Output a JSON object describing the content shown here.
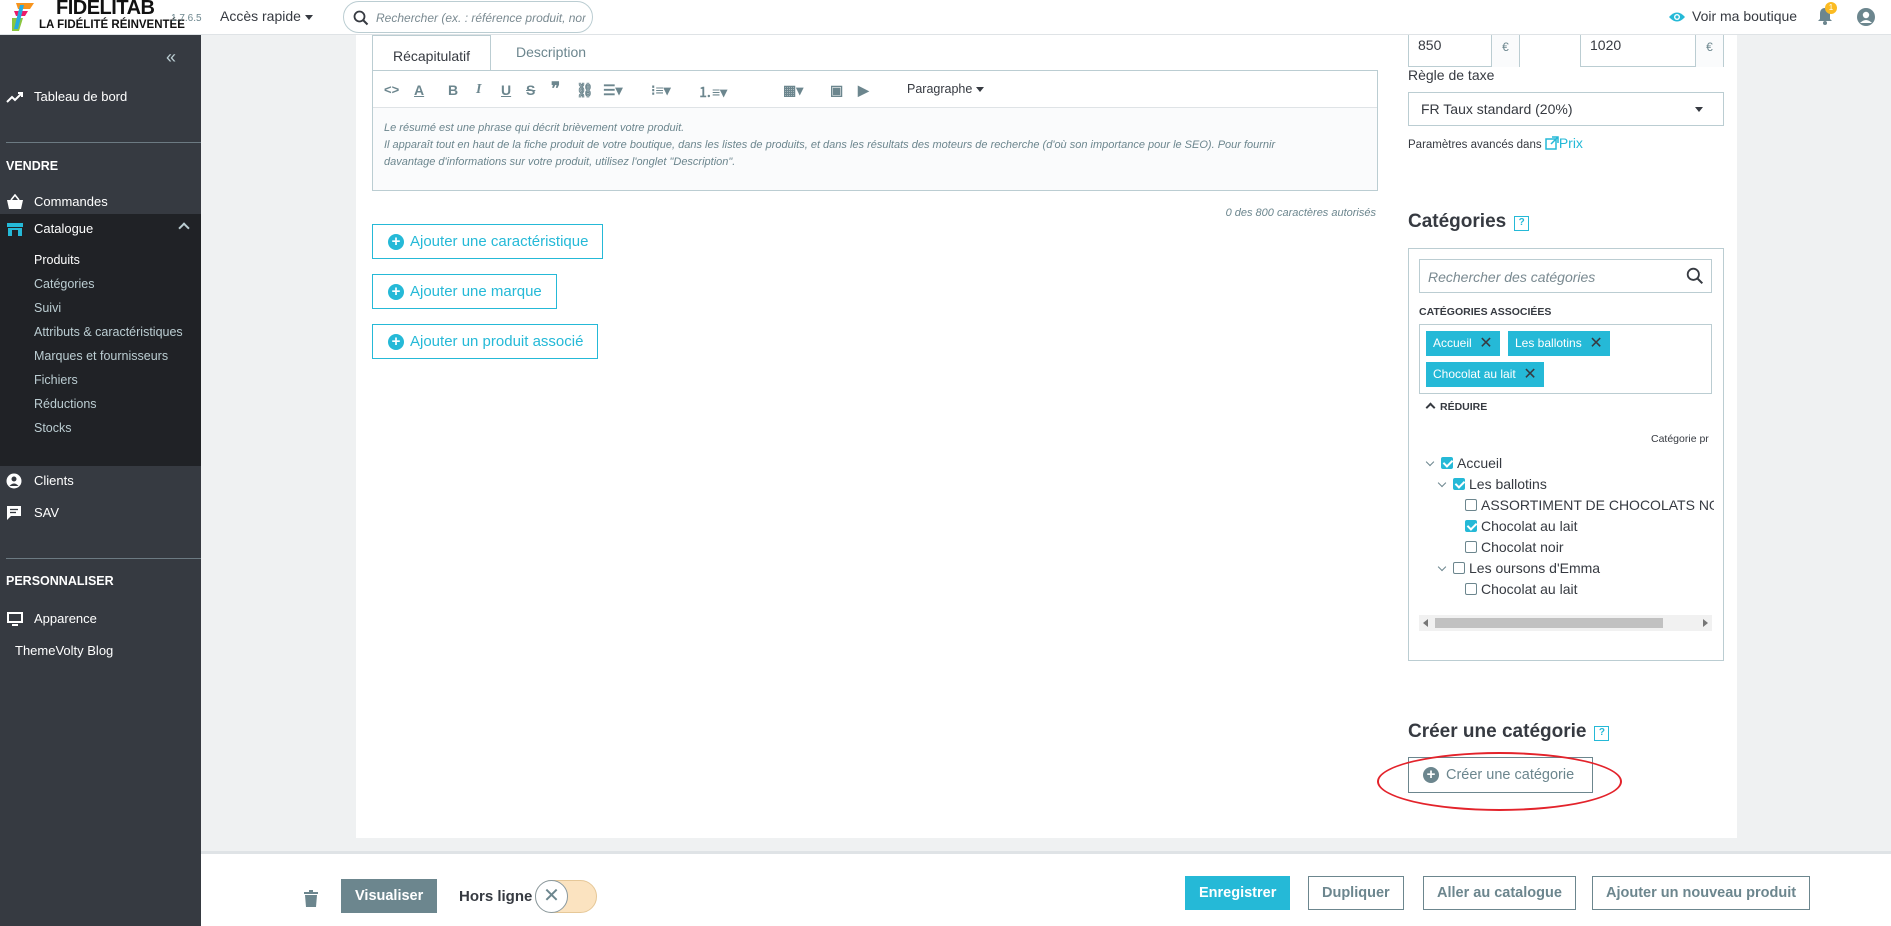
{
  "topbar": {
    "brand": "FIDELITAB",
    "tagline": "LA FIDÉLITÉ RÉINVENTÉE",
    "version": "1.7.6.5",
    "quick_access": "Accès rapide",
    "search_placeholder": "Rechercher (ex. : référence produit, nom",
    "view_shop": "Voir ma boutique",
    "notifications_count": "1"
  },
  "sidebar": {
    "dashboard": "Tableau de bord",
    "section_sell": "VENDRE",
    "orders": "Commandes",
    "catalog": "Catalogue",
    "catalog_items": [
      "Produits",
      "Catégories",
      "Suivi",
      "Attributs & caractéristiques",
      "Marques et fournisseurs",
      "Fichiers",
      "Réductions",
      "Stocks"
    ],
    "clients": "Clients",
    "sav": "SAV",
    "section_customize": "PERSONNALISER",
    "appearance": "Apparence",
    "blog": "ThemeVolty Blog"
  },
  "editor": {
    "tabs": [
      "Récapitulatif",
      "Description"
    ],
    "paragraph": "Paragraphe",
    "content_lines": [
      "Le résumé est une phrase qui décrit brièvement votre produit.",
      "Il apparaît tout en haut de la fiche produit de votre boutique, dans les listes de produits, et dans les résultats des moteurs de recherche (d'où son importance pour le SEO). Pour fournir",
      "davantage d'informations sur votre produit, utilisez l'onglet \"Description\"."
    ],
    "counter": "0 des 800 caractères autorisés"
  },
  "actions": {
    "add_feature": "Ajouter une caractéristique",
    "add_brand": "Ajouter une marque",
    "add_related": "Ajouter un produit associé"
  },
  "pricing": {
    "price_ht": "850",
    "price_ttc": "1020",
    "currency": "€",
    "tax_rule_label": "Règle de taxe",
    "tax_rule": "FR Taux standard (20%)",
    "advanced": "Paramètres avancés dans",
    "advanced_link": "Prix"
  },
  "categories": {
    "title": "Catégories",
    "help": "?",
    "search_placeholder": "Rechercher des catégories",
    "associated_label": "CATÉGORIES ASSOCIÉES",
    "tags": [
      "Accueil",
      "Les ballotins",
      "Chocolat au lait"
    ],
    "tag_remove": "✕",
    "reduce": "RÉDUIRE",
    "main_category_col": "Catégorie pr",
    "tree": [
      {
        "label": "Accueil",
        "checked": true
      },
      {
        "label": "Les ballotins",
        "checked": true
      },
      {
        "label": "ASSORTIMENT DE CHOCOLATS NOIRS",
        "checked": false
      },
      {
        "label": "Chocolat au lait",
        "checked": true
      },
      {
        "label": "Chocolat noir",
        "checked": false
      },
      {
        "label": "Les oursons d'Emma",
        "checked": false
      },
      {
        "label": "Chocolat au lait",
        "checked": false
      }
    ]
  },
  "create_category": {
    "title": "Créer une catégorie",
    "button": "Créer une catégorie"
  },
  "footer": {
    "preview": "Visualiser",
    "offline": "Hors ligne",
    "save": "Enregistrer",
    "duplicate": "Dupliquer",
    "go_catalog": "Aller au catalogue",
    "add_new": "Ajouter un nouveau produit"
  },
  "colors": {
    "accent": "#25b9d7",
    "sidebar": "#363a41",
    "annotation": "#e3232b"
  }
}
